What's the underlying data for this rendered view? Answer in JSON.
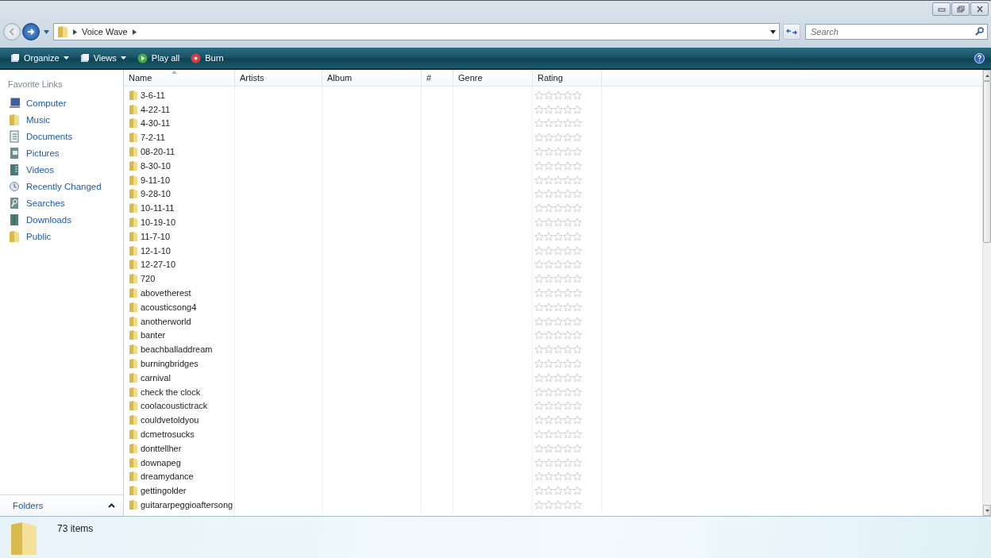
{
  "address": {
    "crumbs": [
      "Voice Wave"
    ]
  },
  "search": {
    "placeholder": "Search"
  },
  "toolbar": [
    {
      "label": "Organize",
      "kind": "menu"
    },
    {
      "label": "Views",
      "kind": "menu"
    },
    {
      "label": "Play all",
      "kind": "play"
    },
    {
      "label": "Burn",
      "kind": "burn"
    }
  ],
  "sidebar": {
    "heading": "Favorite Links",
    "items": [
      {
        "label": "Computer",
        "kind": "computer"
      },
      {
        "label": "Music",
        "kind": "folder"
      },
      {
        "label": "Documents",
        "kind": "documents"
      },
      {
        "label": "Pictures",
        "kind": "pictures"
      },
      {
        "label": "Videos",
        "kind": "videos"
      },
      {
        "label": "Recently Changed",
        "kind": "recent"
      },
      {
        "label": "Searches",
        "kind": "searches"
      },
      {
        "label": "Downloads",
        "kind": "downloads"
      },
      {
        "label": "Public",
        "kind": "folder"
      }
    ],
    "folders": "Folders"
  },
  "table": {
    "columns": [
      "Name",
      "Artists",
      "Album",
      "#",
      "Genre",
      "Rating"
    ],
    "rows": [
      {
        "name": "3-6-11",
        "stars": 0
      },
      {
        "name": "4-22-11",
        "stars": 0
      },
      {
        "name": "4-30-11",
        "stars": 0
      },
      {
        "name": "7-2-11",
        "stars": 0
      },
      {
        "name": "08-20-11",
        "stars": 0
      },
      {
        "name": "8-30-10",
        "stars": 0
      },
      {
        "name": "9-11-10",
        "stars": 0
      },
      {
        "name": "9-28-10",
        "stars": 0
      },
      {
        "name": "10-11-11",
        "stars": 0
      },
      {
        "name": "10-19-10",
        "stars": 0
      },
      {
        "name": "11-7-10",
        "stars": 0
      },
      {
        "name": "12-1-10",
        "stars": 0
      },
      {
        "name": "12-27-10",
        "stars": 0
      },
      {
        "name": "720",
        "stars": 0
      },
      {
        "name": "abovetherest",
        "stars": 0
      },
      {
        "name": "acousticsong4",
        "stars": 0
      },
      {
        "name": "anotherworld",
        "stars": 0
      },
      {
        "name": "banter",
        "stars": 0
      },
      {
        "name": "beachballaddream",
        "stars": 0
      },
      {
        "name": "burningbridges",
        "stars": 0
      },
      {
        "name": "carnival",
        "stars": 0
      },
      {
        "name": "check the clock",
        "stars": 0
      },
      {
        "name": "coolacoustictrack",
        "stars": 0
      },
      {
        "name": "couldvetoldyou",
        "stars": 0
      },
      {
        "name": "dcmetrosucks",
        "stars": 0
      },
      {
        "name": "donttellher",
        "stars": 0
      },
      {
        "name": "downapeg",
        "stars": 0
      },
      {
        "name": "dreamydance",
        "stars": 0
      },
      {
        "name": "gettingolder",
        "stars": 0
      },
      {
        "name": "guitararpeggioaftersong",
        "stars": 0
      }
    ]
  },
  "details": {
    "count": "73 items"
  }
}
